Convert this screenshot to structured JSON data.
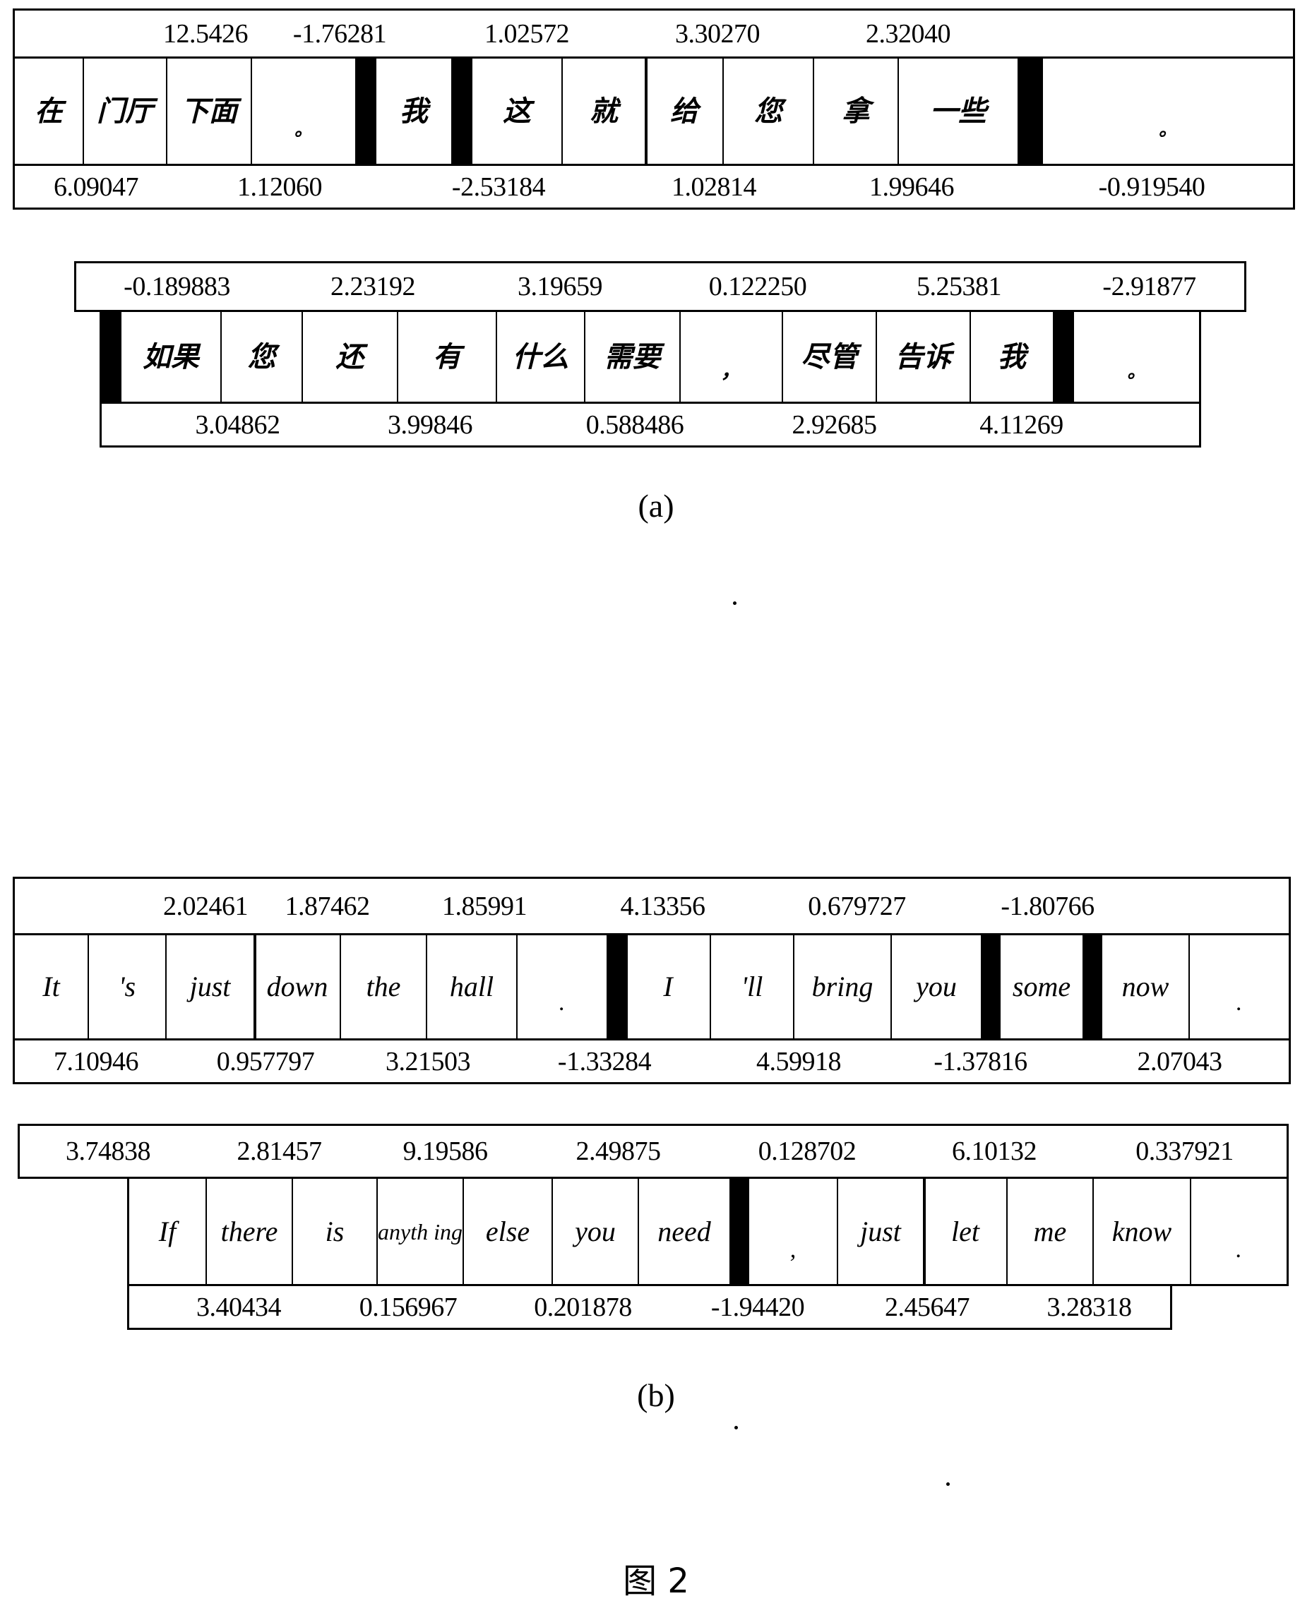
{
  "figure": {
    "caption": "图 2",
    "sub_label_a": "(a)",
    "sub_label_b": "(b)"
  },
  "panel_a": {
    "label": "(a)",
    "language": "Chinese",
    "table1": {
      "top_scores": [
        "12.5426",
        "-1.76281",
        "1.02572",
        "3.30270",
        "2.32040"
      ],
      "tokens": [
        "在",
        "门厅",
        "下面",
        "。",
        "",
        "我",
        "",
        "这",
        "就",
        "给",
        "您",
        "拿",
        "一些",
        "",
        "。"
      ],
      "bottom_scores": [
        "6.09047",
        "1.12060",
        "-2.53184",
        "1.02814",
        "1.99646",
        "-0.919540"
      ]
    },
    "table2": {
      "top_scores": [
        "-0.189883",
        "2.23192",
        "3.19659",
        "0.122250",
        "5.25381",
        "-2.91877"
      ],
      "tokens": [
        "",
        "如果",
        "您",
        "还",
        "有",
        "什么",
        "需要",
        "，",
        "尽管",
        "告诉",
        "我",
        "",
        "。"
      ],
      "bottom_scores": [
        "3.04862",
        "3.99846",
        "0.588486",
        "2.92685",
        "4.11269"
      ]
    }
  },
  "panel_b": {
    "label": "(b)",
    "language": "English",
    "table1": {
      "top_scores": [
        "2.02461",
        "1.87462",
        "1.85991",
        "4.13356",
        "0.679727",
        "-1.80766"
      ],
      "tokens": [
        "It",
        "'s",
        "just",
        "down",
        "the",
        "hall",
        ".",
        "",
        "I",
        "'ll",
        "bring",
        "you",
        "",
        "some",
        "",
        "now",
        "."
      ],
      "bottom_scores": [
        "7.10946",
        "0.957797",
        "3.21503",
        "-1.33284",
        "4.59918",
        "-1.37816",
        "2.07043"
      ]
    },
    "table2": {
      "top_scores": [
        "3.74838",
        "2.81457",
        "9.19586",
        "2.49875",
        "0.128702",
        "6.10132",
        "0.337921"
      ],
      "tokens": [
        "If",
        "there",
        "is",
        "anyth ing",
        "else",
        "you",
        "need",
        "",
        ",",
        "just",
        "let",
        "me",
        "know",
        "."
      ],
      "bottom_scores": [
        "3.40434",
        "0.156967",
        "0.201878",
        "-1.94420",
        "2.45647",
        "3.28318"
      ]
    }
  },
  "chart_data": {
    "type": "table",
    "title": "图 2",
    "panels": [
      {
        "name": "(a)",
        "tables": [
          {
            "top_scores": [
              "12.5426",
              "-1.76281",
              "1.02572",
              "3.30270",
              "2.32040"
            ],
            "tokens": [
              "在",
              "门厅",
              "下面",
              "。",
              "BAR",
              "我",
              "BAR",
              "这",
              "就",
              "给",
              "您",
              "拿",
              "一些",
              "BAR",
              "。"
            ],
            "bottom_scores": [
              "6.09047",
              "1.12060",
              "-2.53184",
              "1.02814",
              "1.99646",
              "-0.919540"
            ]
          },
          {
            "top_scores": [
              "-0.189883",
              "2.23192",
              "3.19659",
              "0.122250",
              "5.25381",
              "-2.91877"
            ],
            "tokens": [
              "BAR",
              "如果",
              "您",
              "还",
              "有",
              "什么",
              "需要",
              "，",
              "尽管",
              "告诉",
              "我",
              "BAR",
              "。"
            ],
            "bottom_scores": [
              "3.04862",
              "3.99846",
              "0.588486",
              "2.92685",
              "4.11269"
            ]
          }
        ]
      },
      {
        "name": "(b)",
        "tables": [
          {
            "top_scores": [
              "2.02461",
              "1.87462",
              "1.85991",
              "4.13356",
              "0.679727",
              "-1.80766"
            ],
            "tokens": [
              "It",
              "'s",
              "just",
              "down",
              "the",
              "hall",
              ".",
              "BAR",
              "I",
              "'ll",
              "bring",
              "you",
              "BAR",
              "some",
              "BAR",
              "now",
              "."
            ],
            "bottom_scores": [
              "7.10946",
              "0.957797",
              "3.21503",
              "-1.33284",
              "4.59918",
              "-1.37816",
              "2.07043"
            ]
          },
          {
            "top_scores": [
              "3.74838",
              "2.81457",
              "9.19586",
              "2.49875",
              "0.128702",
              "6.10132",
              "0.337921"
            ],
            "tokens": [
              "If",
              "there",
              "is",
              "anyth ing",
              "else",
              "you",
              "need",
              "BAR",
              ",",
              "just",
              "let",
              "me",
              "know",
              "."
            ],
            "bottom_scores": [
              "3.40434",
              "0.156967",
              "0.201878",
              "-1.94420",
              "2.45647",
              "3.28318"
            ]
          }
        ]
      }
    ]
  }
}
